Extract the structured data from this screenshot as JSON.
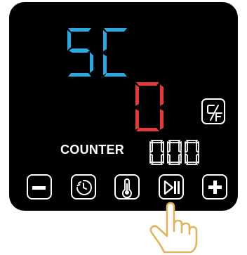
{
  "display": {
    "program_code": "5C",
    "value": "0",
    "counter_label": "COUNTER",
    "counter_value": "000"
  },
  "colors": {
    "panel": "#000000",
    "program_digits": "#29a9e1",
    "value_digit": "#e53935",
    "foreground": "#ffffff",
    "hand_outline": "#e2b45a"
  },
  "buttons": [
    {
      "id": "minus",
      "icon": "minus-icon"
    },
    {
      "id": "timer",
      "icon": "timer-icon"
    },
    {
      "id": "temperature",
      "icon": "thermometer-icon"
    },
    {
      "id": "play_pause",
      "icon": "play-pause-icon"
    },
    {
      "id": "plus",
      "icon": "plus-icon"
    }
  ],
  "unit_toggle": {
    "icon": "celsius-fahrenheit-icon"
  }
}
